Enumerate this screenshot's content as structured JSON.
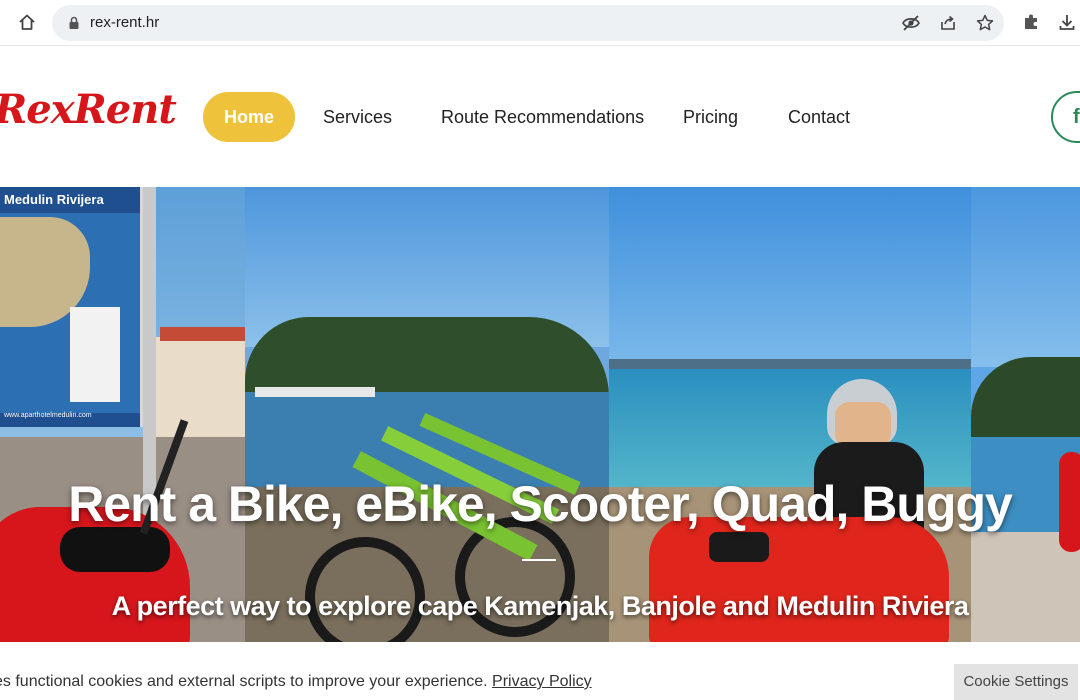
{
  "browser": {
    "url": "rex-rent.hr",
    "icons": [
      "home-icon",
      "lock-icon",
      "eye-off-icon",
      "share-icon",
      "star-icon",
      "puzzle-icon",
      "download-icon"
    ]
  },
  "site": {
    "logo": {
      "part1": "Rex",
      "part2": "Rent"
    },
    "nav": [
      {
        "label": "Home",
        "active": true
      },
      {
        "label": "Services",
        "active": false
      },
      {
        "label": "Route Recommendations",
        "active": false
      },
      {
        "label": "Pricing",
        "active": false
      },
      {
        "label": "Contact",
        "active": false
      }
    ],
    "social_label": "f",
    "colors": {
      "brand_red": "#d7161c",
      "accent_yellow": "#eec23a",
      "social_green": "#2b8a5a"
    }
  },
  "hero": {
    "title": "Rent a Bike, eBike, Scooter, Quad, Buggy",
    "subtitle": "A perfect way to explore cape Kamenjak, Banjole and Medulin Riviera",
    "map_sign_label": "Medulin Rivijera",
    "map_sign_footer": "www.aparthotelmedulin.com"
  },
  "cookie": {
    "text": "es functional cookies and external scripts to improve your experience.",
    "link": "Privacy Policy",
    "button": "Cookie Settings"
  }
}
